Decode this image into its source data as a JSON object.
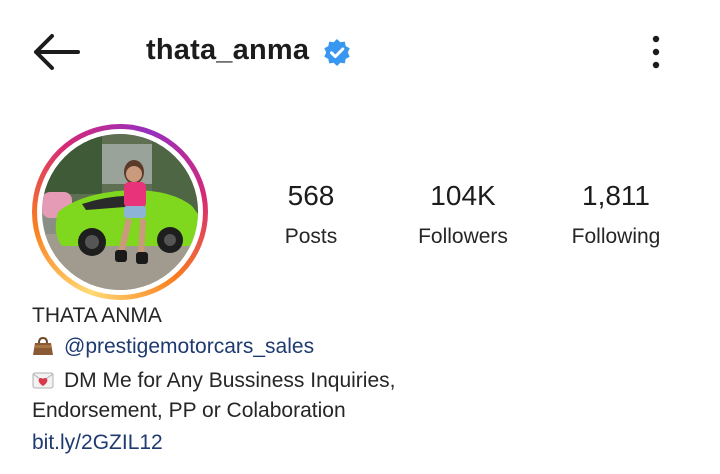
{
  "header": {
    "username": "thata_anma",
    "verified": true,
    "back_icon": "arrow-left-icon",
    "more_icon": "more-vertical-icon"
  },
  "profile": {
    "avatar_alt": "profile photo with green sports car",
    "story_ring_colors": [
      "#feda75",
      "#fa7e1e",
      "#d62976",
      "#962fbf"
    ]
  },
  "stats": [
    {
      "value": "568",
      "label": "Posts"
    },
    {
      "value": "104K",
      "label": "Followers"
    },
    {
      "value": "1,811",
      "label": "Following"
    }
  ],
  "bio": {
    "name": "THATA ANMA",
    "mention": "@prestigemotorcars_sales",
    "mention_icon": "handbag-emoji",
    "line1": "DM Me for Any Bussiness Inquiries,",
    "line1_icon": "love-letter-emoji",
    "line2": "Endorsement, PP or Colaboration",
    "link": "bit.ly/2GZIL12"
  },
  "colors": {
    "verified_badge": "#3897f0",
    "link_text": "#1f3a70",
    "car_green": "#7fd81e"
  }
}
